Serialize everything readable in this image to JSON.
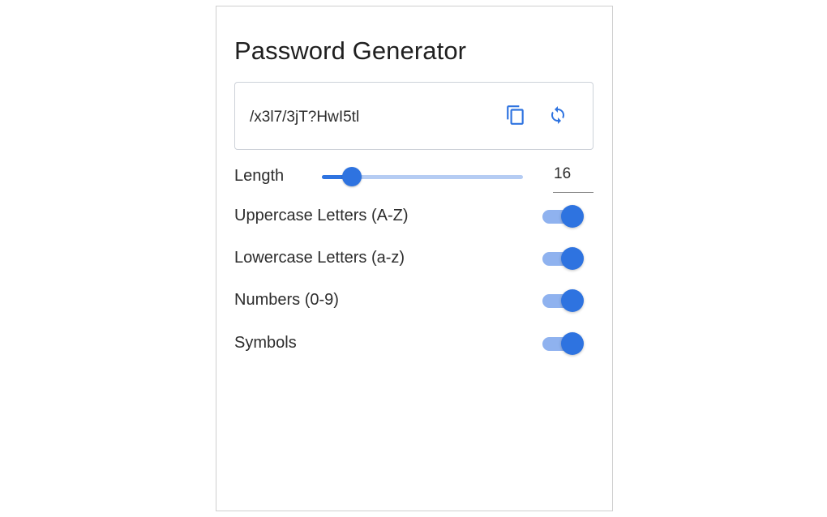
{
  "app": {
    "title": "Password Generator"
  },
  "password": {
    "value": "/x3l7/3jT?HwI5tl",
    "copy_icon": "copy-icon",
    "refresh_icon": "refresh-icon"
  },
  "length": {
    "label": "Length",
    "value": "16",
    "slider_fraction": 0.15
  },
  "options": [
    {
      "label": "Uppercase Letters (A-Z)",
      "enabled": true
    },
    {
      "label": "Lowercase Letters (a-z)",
      "enabled": true
    },
    {
      "label": "Numbers (0-9)",
      "enabled": true
    },
    {
      "label": "Symbols",
      "enabled": true
    }
  ],
  "colors": {
    "accent": "#2e73e0",
    "accent_light": "#8fb2ef",
    "track_light": "#b5ccf3"
  }
}
